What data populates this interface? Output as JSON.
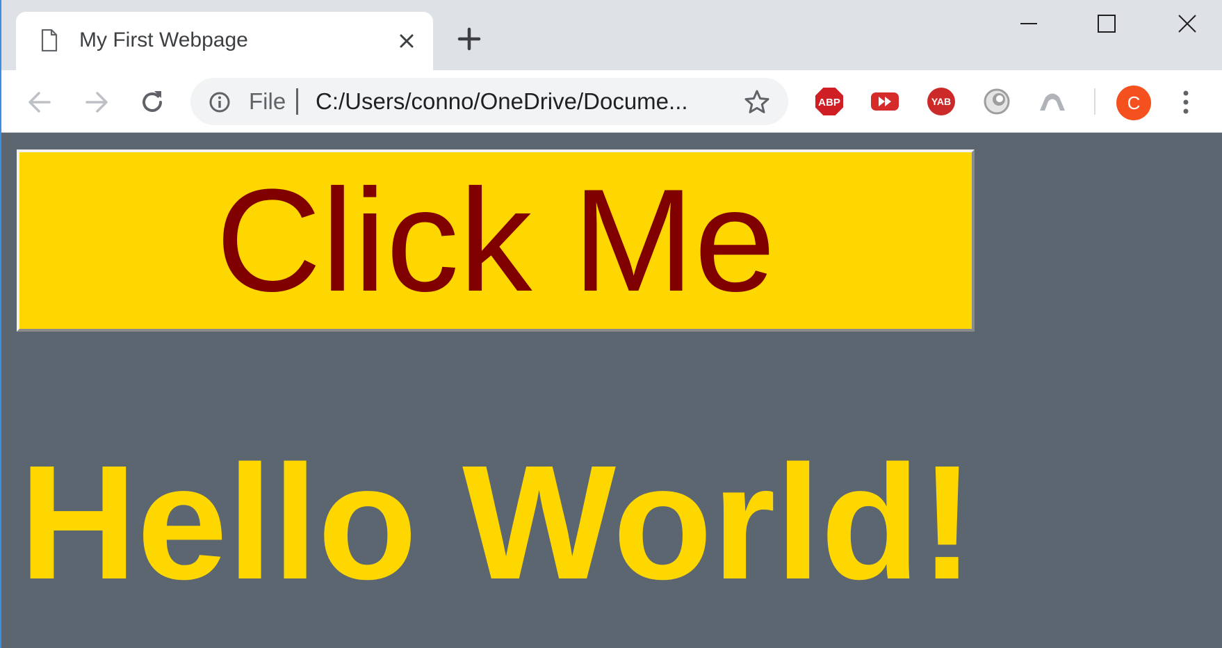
{
  "tab": {
    "title": "My First Webpage"
  },
  "omnibox": {
    "scheme_label": "File",
    "url": "C:/Users/conno/OneDrive/Docume..."
  },
  "toolbar": {
    "profile_initial": "C"
  },
  "icons": {
    "tab_favicon": "page-icon",
    "tab_close": "close-icon",
    "new_tab": "plus-icon",
    "back": "arrow-left-icon",
    "forward": "arrow-right-icon",
    "reload": "reload-icon",
    "site_info": "info-icon",
    "bookmark": "star-icon",
    "menu": "kebab-menu-icon"
  },
  "extensions": [
    {
      "name": "adblock-plus-icon",
      "label": "ABP"
    },
    {
      "name": "youtube-skip-icon",
      "label": ""
    },
    {
      "name": "yab-icon",
      "label": "YAB"
    },
    {
      "name": "round-extension-icon",
      "label": ""
    },
    {
      "name": "arc-extension-icon",
      "label": ""
    }
  ],
  "page": {
    "button_label": "Click Me",
    "heading": "Hello World!"
  },
  "colors": {
    "page_background": "#5c6670",
    "button_background": "#ffd700",
    "button_text": "#800000",
    "heading_text": "#ffd700",
    "avatar": "#f4511e"
  }
}
